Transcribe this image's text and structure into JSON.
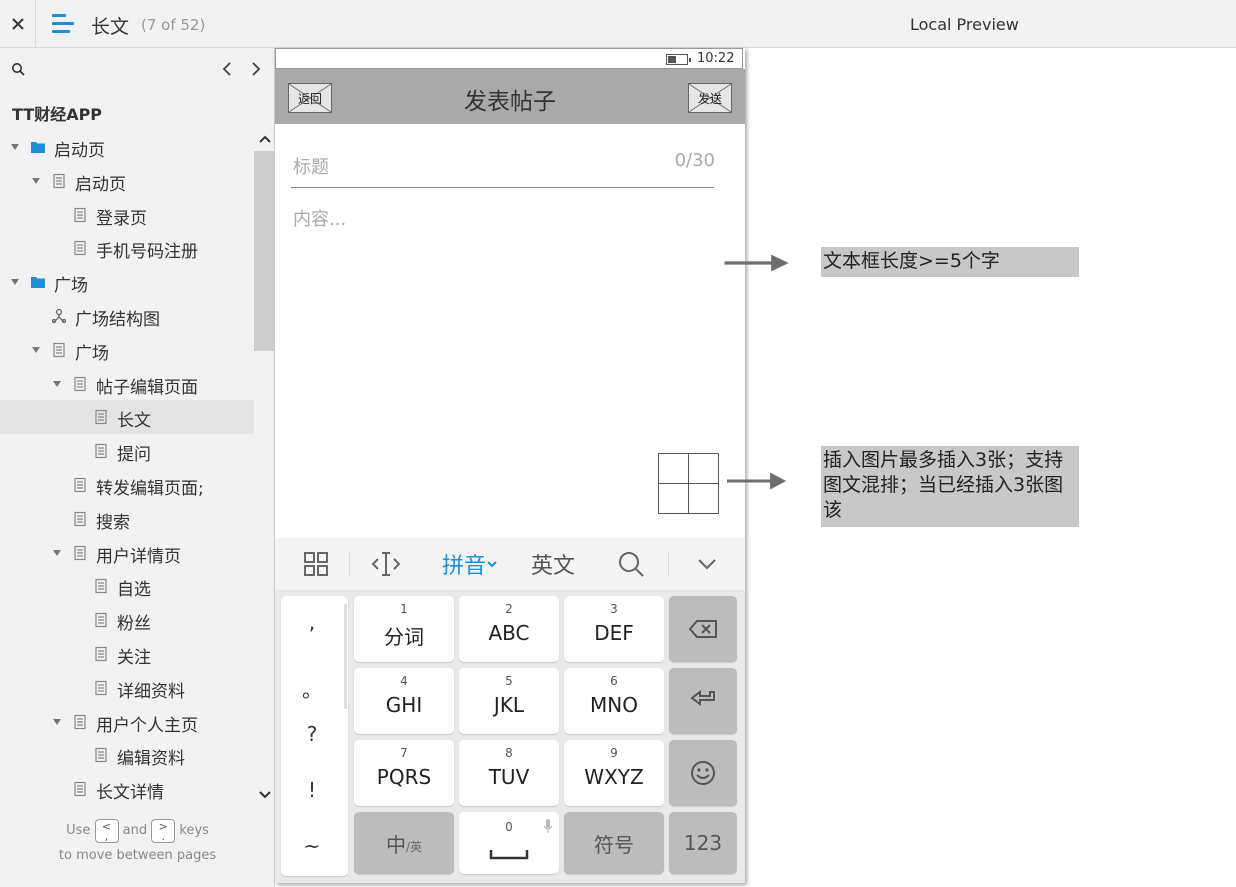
{
  "topbar": {
    "close_icon": "close-icon",
    "menu_icon": "hamburger-icon",
    "page_name": "长文",
    "page_count": "(7 of 52)",
    "preview_title": "Local Preview"
  },
  "sidebar": {
    "search_icon": "search-icon",
    "project_title": "TT财经APP",
    "items": [
      {
        "label": "启动页",
        "type": "folder",
        "caret": true
      },
      {
        "label": "启动页",
        "type": "page",
        "caret": true
      },
      {
        "label": "登录页",
        "type": "page",
        "caret": false
      },
      {
        "label": "手机号码注册",
        "type": "page",
        "caret": false
      },
      {
        "label": "广场",
        "type": "folder",
        "caret": true
      },
      {
        "label": "广场结构图",
        "type": "flow",
        "caret": false
      },
      {
        "label": "广场",
        "type": "page",
        "caret": true
      },
      {
        "label": "帖子编辑页面",
        "type": "page",
        "caret": true
      },
      {
        "label": "长文",
        "type": "page",
        "caret": false,
        "selected": true
      },
      {
        "label": "提问",
        "type": "page",
        "caret": false
      },
      {
        "label": "转发编辑页面;",
        "type": "page",
        "caret": false
      },
      {
        "label": "搜索",
        "type": "page",
        "caret": false
      },
      {
        "label": "用户详情页",
        "type": "page",
        "caret": true
      },
      {
        "label": "自选",
        "type": "page",
        "caret": false
      },
      {
        "label": "粉丝",
        "type": "page",
        "caret": false
      },
      {
        "label": "关注",
        "type": "page",
        "caret": false
      },
      {
        "label": "详细资料",
        "type": "page",
        "caret": false
      },
      {
        "label": "用户个人主页",
        "type": "page",
        "caret": true
      },
      {
        "label": "编辑资料",
        "type": "page",
        "caret": false
      },
      {
        "label": "长文详情",
        "type": "page",
        "caret": false
      }
    ],
    "hint": {
      "use": "Use",
      "prev_key": "<\n,",
      "and": "and",
      "next_key": ">\n.",
      "keys": "keys",
      "line2": "to move between pages"
    }
  },
  "phone": {
    "clock": "10:22",
    "appbar": {
      "title": "发表帖子",
      "back": "返回",
      "send": "发送"
    },
    "title_placeholder": "标题",
    "title_counter": "0/30",
    "content_placeholder": "内容..."
  },
  "keyboard": {
    "toolbar": {
      "pinyin": "拼音",
      "english": "英文"
    },
    "punctuation": [
      ",",
      "。",
      "?",
      "!",
      "~"
    ],
    "keys": [
      {
        "num": "1",
        "letters": "分词"
      },
      {
        "num": "2",
        "letters": "ABC"
      },
      {
        "num": "3",
        "letters": "DEF"
      },
      {
        "num": "4",
        "letters": "GHI"
      },
      {
        "num": "5",
        "letters": "JKL"
      },
      {
        "num": "6",
        "letters": "MNO"
      },
      {
        "num": "7",
        "letters": "PQRS"
      },
      {
        "num": "8",
        "letters": "TUV"
      },
      {
        "num": "9",
        "letters": "WXYZ"
      }
    ],
    "zh": "中",
    "zh_sub": "/英",
    "space_num": "0",
    "symbols": "符号",
    "num_switch": "123"
  },
  "annotations": {
    "note1": "文本框长度>=5个字",
    "note2": "插入图片最多插入3张；支持图文混排；当已经插入3张图该"
  },
  "colors": {
    "accent": "#1d8fd8",
    "appbar": "#a9a9a9",
    "note_bg": "#c8c8c8",
    "arrow": "#6e6e6e"
  }
}
